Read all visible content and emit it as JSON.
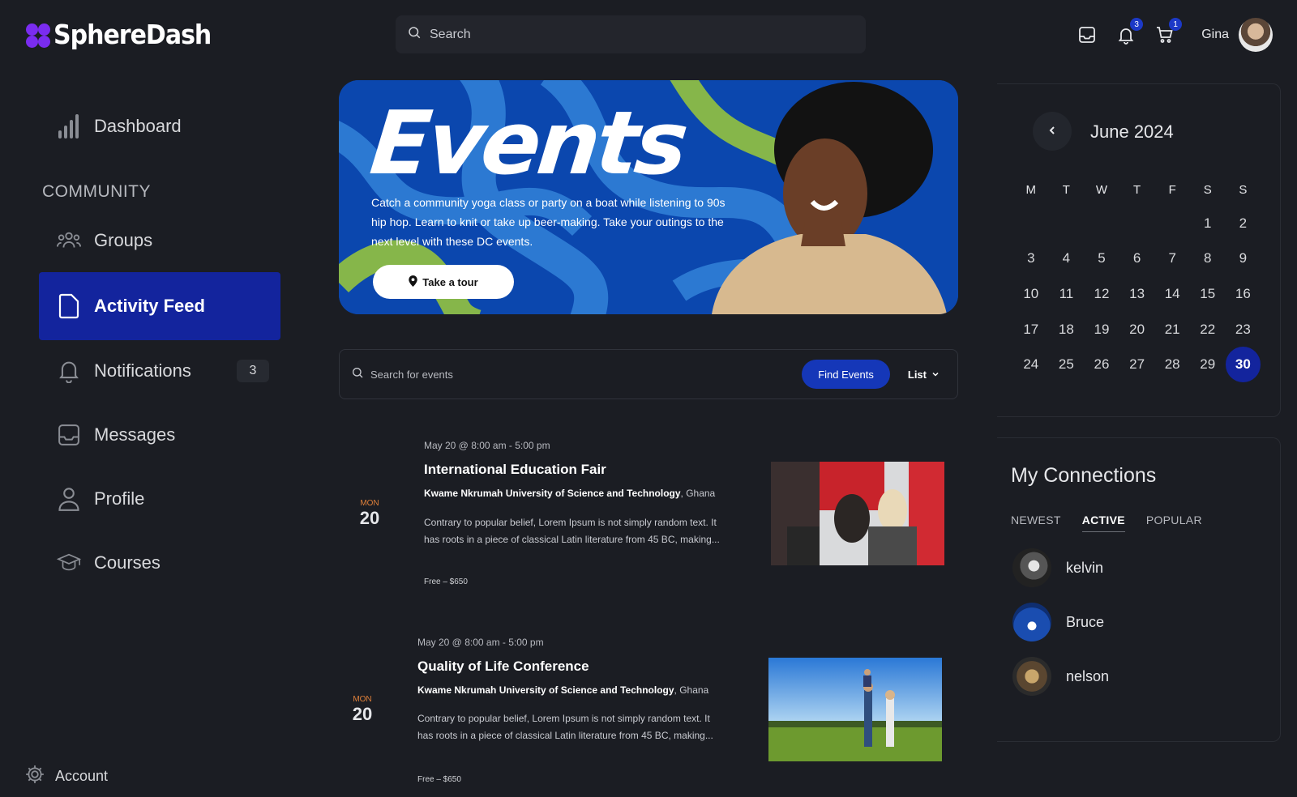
{
  "brand": {
    "name": "SphereDash",
    "accent": "#7a2cf0"
  },
  "header": {
    "search_placeholder": "Search",
    "notifications_badge": "3",
    "cart_badge": "1",
    "user_name": "Gina"
  },
  "sidebar": {
    "dashboard": "Dashboard",
    "section": "COMMUNITY",
    "groups": "Groups",
    "activity_feed": "Activity Feed",
    "notifications": "Notifications",
    "notifications_count": "3",
    "messages": "Messages",
    "profile": "Profile",
    "courses": "Courses",
    "account": "Account",
    "active_color": "#13249d"
  },
  "banner": {
    "title": "Events",
    "description": "Catch a community yoga class or party on a boat while listening to 90s hip hop. Learn to knit or take up beer-making. Take your outings to the next level with these DC events.",
    "button": "Take a tour"
  },
  "event_search": {
    "placeholder": "Search for events",
    "find_button": "Find Events",
    "view": "List"
  },
  "events": [
    {
      "dow": "MON",
      "day": "20",
      "time": "May 20 @ 8:00 am - 5:00 pm",
      "title": "International Education Fair",
      "venue": "Kwame Nkrumah University of Science and Technology",
      "location": ", Ghana",
      "description": "Contrary to popular belief, Lorem Ipsum is not simply random text. It has roots in a piece of classical Latin literature from 45 BC, making...",
      "price": "Free – $650"
    },
    {
      "dow": "MON",
      "day": "20",
      "time": "May 20 @ 8:00 am - 5:00 pm",
      "title": "Quality of Life Conference",
      "venue": "Kwame Nkrumah University of Science and Technology",
      "location": ", Ghana",
      "description": "Contrary to popular belief, Lorem Ipsum is not simply random text. It has roots in a piece of classical Latin literature from 45 BC, making...",
      "price": "Free – $650"
    }
  ],
  "calendar": {
    "title": "June 2024",
    "weekdays": [
      "M",
      "T",
      "W",
      "T",
      "F",
      "S",
      "S"
    ],
    "leading_blanks": 5,
    "days_in_month": 30,
    "selected_day": 30
  },
  "connections": {
    "title": "My Connections",
    "tabs": [
      "NEWEST",
      "ACTIVE",
      "POPULAR"
    ],
    "active_tab": "ACTIVE",
    "people": [
      {
        "name": "kelvin"
      },
      {
        "name": "Bruce"
      },
      {
        "name": "nelson"
      }
    ]
  }
}
